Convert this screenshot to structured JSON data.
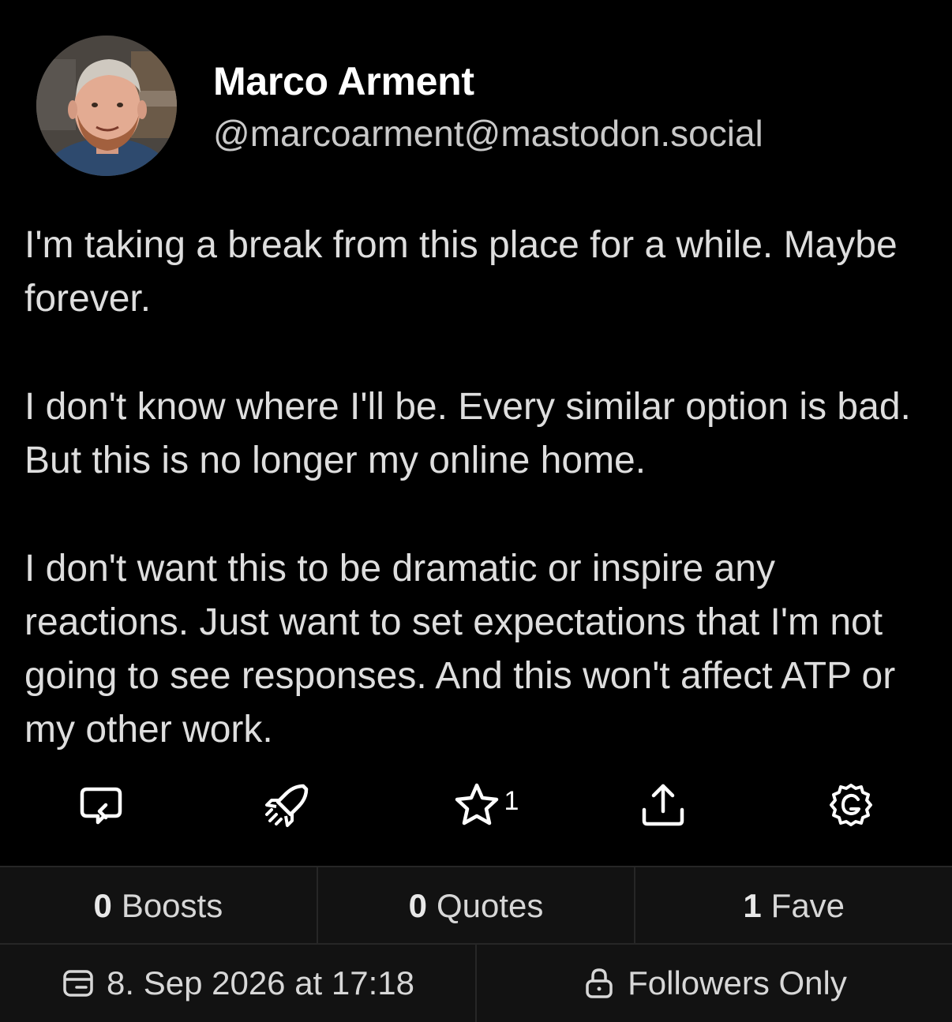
{
  "author": {
    "name": "Marco Arment",
    "handle": "@marcoarment@mastodon.social",
    "avatar_icon": "profile-photo"
  },
  "post": {
    "paragraphs": [
      "I'm taking a break from this place for a while. Maybe forever.",
      "I don't know where I'll be. Every similar option is bad. But this is no longer my online home.",
      "I don't want this to be dramatic or inspire any reactions. Just want to set expectations that I'm not going to see responses. And this won't affect ATP or my other work."
    ]
  },
  "actions": {
    "reply_icon": "reply-bubble-icon",
    "boost_icon": "rocket-boost-icon",
    "favorite_icon": "star-icon",
    "favorite_count": "1",
    "share_icon": "share-upload-icon",
    "more_icon": "gear-icon"
  },
  "stats": {
    "boosts_count": "0",
    "boosts_label": "Boosts",
    "quotes_count": "0",
    "quotes_label": "Quotes",
    "faves_count": "1",
    "faves_label": "Fave"
  },
  "meta": {
    "timestamp": "8. Sep 2026 at 17:18",
    "visibility": "Followers Only",
    "calendar_icon": "calendar-icon",
    "lock_icon": "lock-icon"
  },
  "colors": {
    "background": "#000000",
    "panel": "#121212",
    "divider": "#262626",
    "body_text": "#dedede",
    "secondary_text": "#c9c9c9"
  }
}
